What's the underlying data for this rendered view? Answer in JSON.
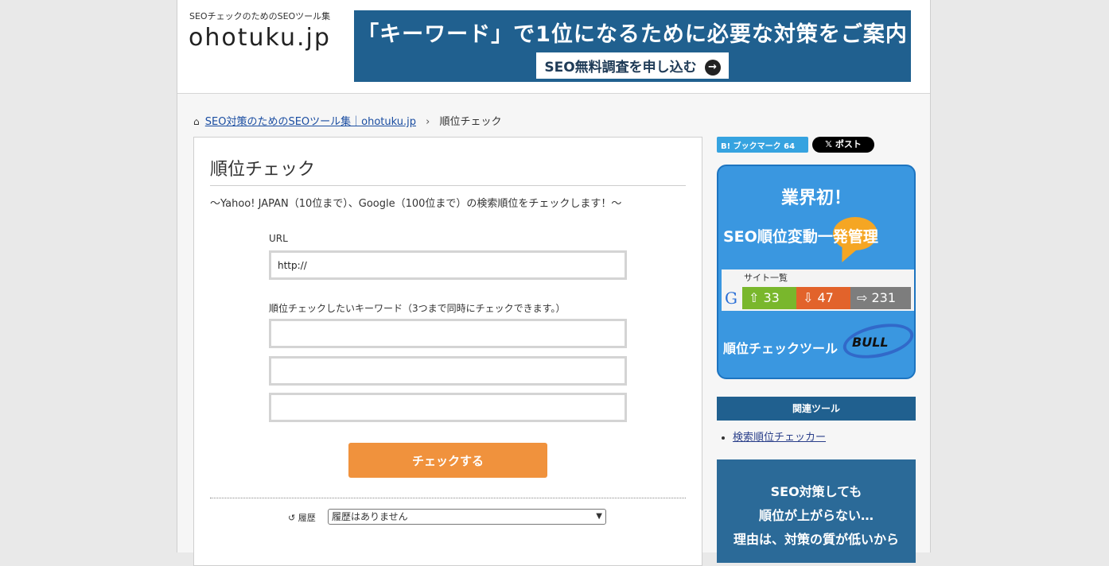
{
  "header": {
    "logo_sub": "SEOチェックのためのSEOツール集",
    "logo": "ohotuku.jp",
    "banner_title": "「キーワード」で1位になるために必要な対策をご案内",
    "banner_button": "SEO無料調査を申し込む",
    "banner_color": "#20608f"
  },
  "breadcrumb": {
    "home_icon": "home-icon",
    "home_link": "SEO対策のためのSEOツール集｜ohotuku.jp",
    "separator": "›",
    "current": "順位チェック"
  },
  "main": {
    "title": "順位チェック",
    "lead": "〜Yahoo! JAPAN（10位まで）、Google（100位まで）の検索順位をチェックします！〜",
    "url_label": "URL",
    "url_value": "http://",
    "keyword_label": "順位チェックしたいキーワード（3つまで同時にチェックできます。）",
    "keyword_values": [
      "",
      "",
      ""
    ],
    "check_button": "チェックする",
    "check_button_color": "#f0923d",
    "history_icon": "history-icon",
    "history_label": "履歴",
    "history_selected": "履歴はありません"
  },
  "sidebar": {
    "hatena_label": "B! ブックマーク",
    "hatena_count": "64",
    "x_label": "ポスト",
    "ad1": {
      "line1": "業界初！",
      "line2": "SEO順位変動一発管理",
      "stats_title": "サイト一覧",
      "stats_g": "G",
      "up": "33",
      "down": "47",
      "flat": "231",
      "line3": "順位チェックツール",
      "brand": "BULL"
    },
    "related_heading": "関連ツール",
    "related_items": [
      "検索順位チェッカー"
    ],
    "ad2": {
      "line1": "SEO対策しても",
      "line2": "順位が上がらない…",
      "line3": "理由は、対策の質が低いから"
    }
  }
}
